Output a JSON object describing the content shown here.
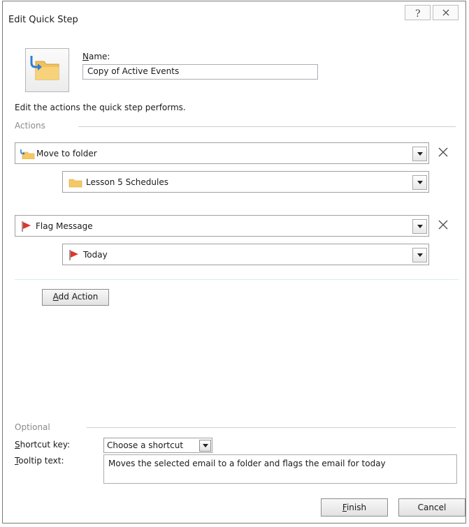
{
  "window": {
    "title": "Edit Quick Step",
    "help_glyph": "?",
    "close_glyph": "✕"
  },
  "name_field": {
    "label_prefix": "N",
    "label_rest": "ame:",
    "value": "Copy of Active Events"
  },
  "instructions": "Edit the actions the quick step performs.",
  "actions_section": {
    "label": "Actions",
    "actions": [
      {
        "label": "Move to folder",
        "icon": "move-to-folder-icon",
        "option": {
          "label": "Lesson 5 Schedules",
          "icon": "folder-icon"
        }
      },
      {
        "label": "Flag Message",
        "icon": "red-flag-icon",
        "option": {
          "label": "Today",
          "icon": "red-flag-icon"
        }
      }
    ],
    "add_action_prefix": "A",
    "add_action_rest": "dd Action"
  },
  "optional_section": {
    "label": "Optional",
    "shortcut_label_prefix": "S",
    "shortcut_label_rest": "hortcut key:",
    "shortcut_value": "Choose a shortcut",
    "tooltip_label_prefix": "T",
    "tooltip_label_rest": "ooltip text:",
    "tooltip_value": "Moves the selected email to a folder and flags the email for today"
  },
  "footer": {
    "finish_prefix": "F",
    "finish_rest": "inish",
    "cancel_label": "Cancel"
  },
  "colors": {
    "folder": "#f5c865",
    "flag": "#e0342c",
    "arrow": "#2f7fd6"
  }
}
